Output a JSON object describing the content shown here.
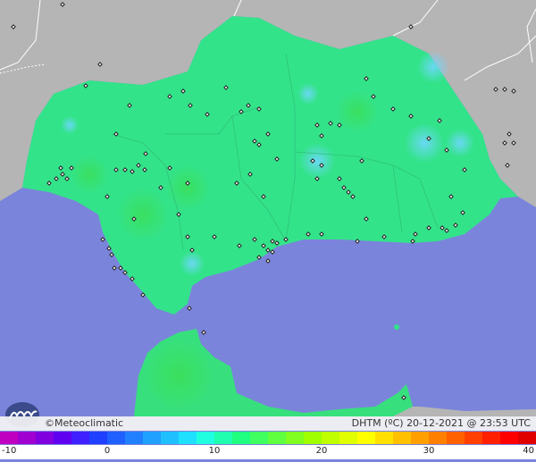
{
  "brand": {
    "name": "©Meteoclimatic",
    "logo_icon": "meteoclimatic-logo-icon"
  },
  "product": {
    "label": "DHTM (ºC)",
    "datetime": "20-12-2021 @ 23:53 UTC"
  },
  "scale": {
    "ticks": [
      "-10",
      "0",
      "10",
      "20",
      "30",
      "40"
    ],
    "min": -10,
    "max": 40,
    "colors": [
      "#c000c0",
      "#a000d0",
      "#8000e0",
      "#6000f0",
      "#4020ff",
      "#2040ff",
      "#2060ff",
      "#2080ff",
      "#20a0ff",
      "#20c0ff",
      "#20e0ff",
      "#20ffe0",
      "#20ffb0",
      "#20ff80",
      "#40ff60",
      "#60ff40",
      "#80ff20",
      "#a0ff00",
      "#c0ff00",
      "#e0ff00",
      "#ffff00",
      "#ffe000",
      "#ffc000",
      "#ffa000",
      "#ff8000",
      "#ff6000",
      "#ff4000",
      "#ff2000",
      "#ff0000",
      "#e00000"
    ]
  },
  "colors": {
    "sea": "#7b84db",
    "land_outside": "#b4b4b4",
    "region_base": "#33e38a"
  }
}
